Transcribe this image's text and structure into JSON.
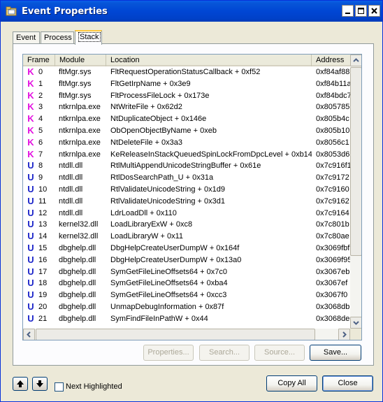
{
  "window": {
    "title": "Event Properties",
    "controls": [
      "minimize",
      "maximize",
      "close"
    ]
  },
  "tabs": [
    {
      "label": "Event",
      "active": false
    },
    {
      "label": "Process",
      "active": false
    },
    {
      "label": "Stack",
      "active": true
    }
  ],
  "stack_table": {
    "columns": [
      "Frame",
      "Module",
      "Location",
      "Address"
    ],
    "rows": [
      {
        "mode": "K",
        "frame": "0",
        "module": "fltMgr.sys",
        "location": "FltRequestOperationStatusCallback + 0xf52",
        "address": "0xf84af88"
      },
      {
        "mode": "K",
        "frame": "1",
        "module": "fltMgr.sys",
        "location": "FltGetIrpName + 0x3e9",
        "address": "0xf84b11a"
      },
      {
        "mode": "K",
        "frame": "2",
        "module": "fltMgr.sys",
        "location": "FltProcessFileLock + 0x173e",
        "address": "0xf84bdc7"
      },
      {
        "mode": "K",
        "frame": "3",
        "module": "ntkrnlpa.exe",
        "location": "NtWriteFile + 0x62d2",
        "address": "0x805785"
      },
      {
        "mode": "K",
        "frame": "4",
        "module": "ntkrnlpa.exe",
        "location": "NtDuplicateObject + 0x146e",
        "address": "0x805b4c"
      },
      {
        "mode": "K",
        "frame": "5",
        "module": "ntkrnlpa.exe",
        "location": "ObOpenObjectByName + 0xeb",
        "address": "0x805b10"
      },
      {
        "mode": "K",
        "frame": "6",
        "module": "ntkrnlpa.exe",
        "location": "NtDeleteFile + 0x3a3",
        "address": "0x8056c1"
      },
      {
        "mode": "K",
        "frame": "7",
        "module": "ntkrnlpa.exe",
        "location": "KeReleaseInStackQueuedSpinLockFromDpcLevel + 0xb14",
        "address": "0x8053d6"
      },
      {
        "mode": "U",
        "frame": "8",
        "module": "ntdll.dll",
        "location": "RtlMultiAppendUnicodeStringBuffer + 0x61e",
        "address": "0x7c916f1"
      },
      {
        "mode": "U",
        "frame": "9",
        "module": "ntdll.dll",
        "location": "RtlDosSearchPath_U + 0x31a",
        "address": "0x7c9172"
      },
      {
        "mode": "U",
        "frame": "10",
        "module": "ntdll.dll",
        "location": "RtlValidateUnicodeString + 0x1d9",
        "address": "0x7c9160"
      },
      {
        "mode": "U",
        "frame": "11",
        "module": "ntdll.dll",
        "location": "RtlValidateUnicodeString + 0x3d1",
        "address": "0x7c9162"
      },
      {
        "mode": "U",
        "frame": "12",
        "module": "ntdll.dll",
        "location": "LdrLoadDll + 0x110",
        "address": "0x7c9164"
      },
      {
        "mode": "U",
        "frame": "13",
        "module": "kernel32.dll",
        "location": "LoadLibraryExW + 0xc8",
        "address": "0x7c801b"
      },
      {
        "mode": "U",
        "frame": "14",
        "module": "kernel32.dll",
        "location": "LoadLibraryW + 0x11",
        "address": "0x7c80ae"
      },
      {
        "mode": "U",
        "frame": "15",
        "module": "dbghelp.dll",
        "location": "DbgHelpCreateUserDumpW + 0x164f",
        "address": "0x3069fbf"
      },
      {
        "mode": "U",
        "frame": "16",
        "module": "dbghelp.dll",
        "location": "DbgHelpCreateUserDumpW + 0x13a0",
        "address": "0x3069f95"
      },
      {
        "mode": "U",
        "frame": "17",
        "module": "dbghelp.dll",
        "location": "SymGetFileLineOffsets64 + 0x7c0",
        "address": "0x3067eb"
      },
      {
        "mode": "U",
        "frame": "18",
        "module": "dbghelp.dll",
        "location": "SymGetFileLineOffsets64 + 0xba4",
        "address": "0x3067ef"
      },
      {
        "mode": "U",
        "frame": "19",
        "module": "dbghelp.dll",
        "location": "SymGetFileLineOffsets64 + 0xcc3",
        "address": "0x3067f0"
      },
      {
        "mode": "U",
        "frame": "20",
        "module": "dbghelp.dll",
        "location": "UnmapDebugInformation + 0x87f",
        "address": "0x3068db"
      },
      {
        "mode": "U",
        "frame": "21",
        "module": "dbghelp.dll",
        "location": "SymFindFileInPathW + 0x44",
        "address": "0x3068de"
      }
    ]
  },
  "actions": {
    "properties": "Properties...",
    "search": "Search...",
    "source": "Source...",
    "save": "Save..."
  },
  "footer": {
    "next_highlighted_label": "Next Highlighted",
    "next_highlighted_checked": false,
    "copy_all": "Copy All",
    "close": "Close"
  },
  "colors": {
    "kernel_badge": "#e30fe0",
    "user_badge": "#1b24c9",
    "titlebar": "#0046d4"
  }
}
